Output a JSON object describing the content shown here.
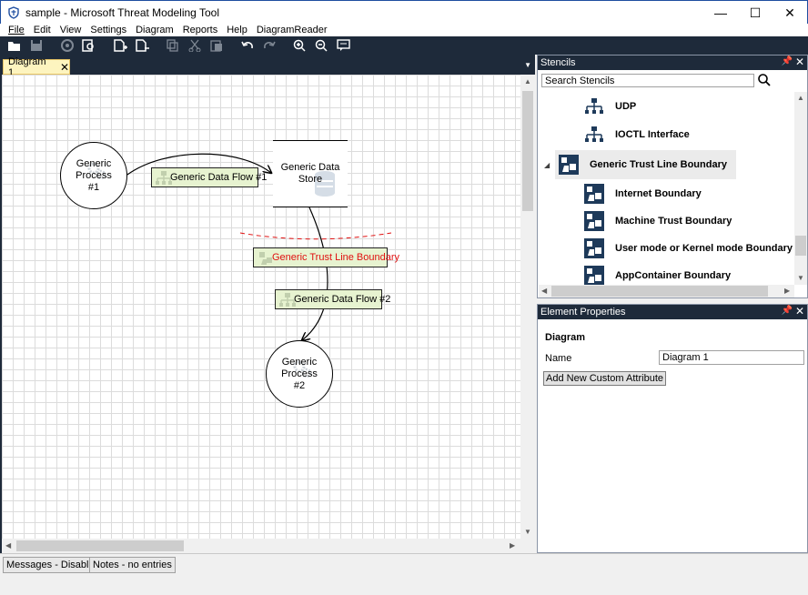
{
  "window": {
    "title": "sample - Microsoft Threat Modeling Tool",
    "controls": {
      "minimize": "—",
      "maximize": "☐",
      "close": "✕"
    }
  },
  "menu": [
    {
      "id": "file",
      "label": "File"
    },
    {
      "id": "edit",
      "label": "Edit"
    },
    {
      "id": "view",
      "label": "View"
    },
    {
      "id": "settings",
      "label": "Settings"
    },
    {
      "id": "diagram",
      "label": "Diagram"
    },
    {
      "id": "reports",
      "label": "Reports"
    },
    {
      "id": "help",
      "label": "Help"
    },
    {
      "id": "diagramreader",
      "label": "DiagramReader"
    }
  ],
  "toolbar": {
    "icons": [
      "open-icon",
      "save-icon",
      "analysis-icon",
      "search-view-icon",
      "new-diagram-icon",
      "remove-diagram-icon",
      "copy-icon",
      "cut-icon",
      "paste-icon",
      "undo-icon",
      "redo-icon",
      "zoom-in-icon",
      "zoom-out-icon",
      "comment-icon"
    ]
  },
  "document": {
    "tab_label": "Diagram 1",
    "tab_close": "✕"
  },
  "diagram": {
    "processes": [
      {
        "id": "p1",
        "label_line1": "Generic Process",
        "label_line2": "#1"
      },
      {
        "id": "p2",
        "label_line1": "Generic Process",
        "label_line2": "#2"
      }
    ],
    "datastore": {
      "label_line1": "Generic Data",
      "label_line2": "Store"
    },
    "flows": [
      {
        "id": "f1",
        "label": "Generic Data Flow #1"
      },
      {
        "id": "f2",
        "label": "Generic Data Flow #2"
      }
    ],
    "trust_boundary": {
      "label": "Generic Trust Line Boundary",
      "color": "#e01010"
    }
  },
  "stencils": {
    "title": "Stencils",
    "search_value": "Search Stencils",
    "items": [
      {
        "label": "UDP",
        "kind": "flow"
      },
      {
        "label": "IOCTL Interface",
        "kind": "flow"
      },
      {
        "label": "Generic Trust Line Boundary",
        "kind": "boundary-group"
      },
      {
        "label": "Internet Boundary",
        "kind": "boundary"
      },
      {
        "label": "Machine Trust Boundary",
        "kind": "boundary"
      },
      {
        "label": "User mode or Kernel mode Boundary",
        "kind": "boundary"
      },
      {
        "label": "AppContainer Boundary",
        "kind": "boundary"
      }
    ]
  },
  "properties": {
    "title": "Element Properties",
    "section": "Diagram",
    "name_label": "Name",
    "name_value": "Diagram 1",
    "add_attribute_label": "Add New Custom Attribute"
  },
  "status": {
    "messages": "Messages - Disabled",
    "notes": "Notes - no entries"
  },
  "colors": {
    "toolbar_bg": "#1e2a3a",
    "flow_label_bg": "#e7f3d0",
    "tab_bg": "#fdf4bf",
    "boundary": "#e01010"
  }
}
